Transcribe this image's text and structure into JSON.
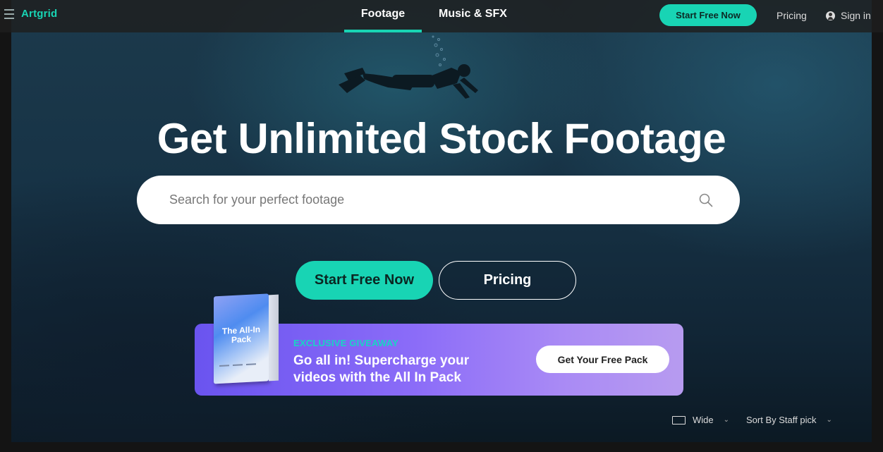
{
  "brand": {
    "logo_text": "Artgrid",
    "accent_color": "#18d4b4"
  },
  "nav": {
    "tabs": [
      {
        "label": "Footage",
        "active": true
      },
      {
        "label": "Music & SFX",
        "active": false
      }
    ],
    "start_label": "Start Free Now",
    "pricing_label": "Pricing",
    "signin_label": "Sign in"
  },
  "hero": {
    "headline": "Get Unlimited Stock Footage",
    "search_placeholder": "Search for your perfect footage",
    "start_button": "Start Free Now",
    "pricing_button": "Pricing"
  },
  "promo": {
    "box_title": "The All-In Pack",
    "eyebrow": "EXCLUSIVE GIVEAWAY",
    "text": "Go all in! Supercharge your videos with the All In Pack",
    "button": "Get Your Free Pack",
    "colors": {
      "start": "#6a54ef",
      "end": "#b79bf0"
    }
  },
  "filters": {
    "view_label": "Wide",
    "sort_label": "Sort By Staff pick"
  }
}
